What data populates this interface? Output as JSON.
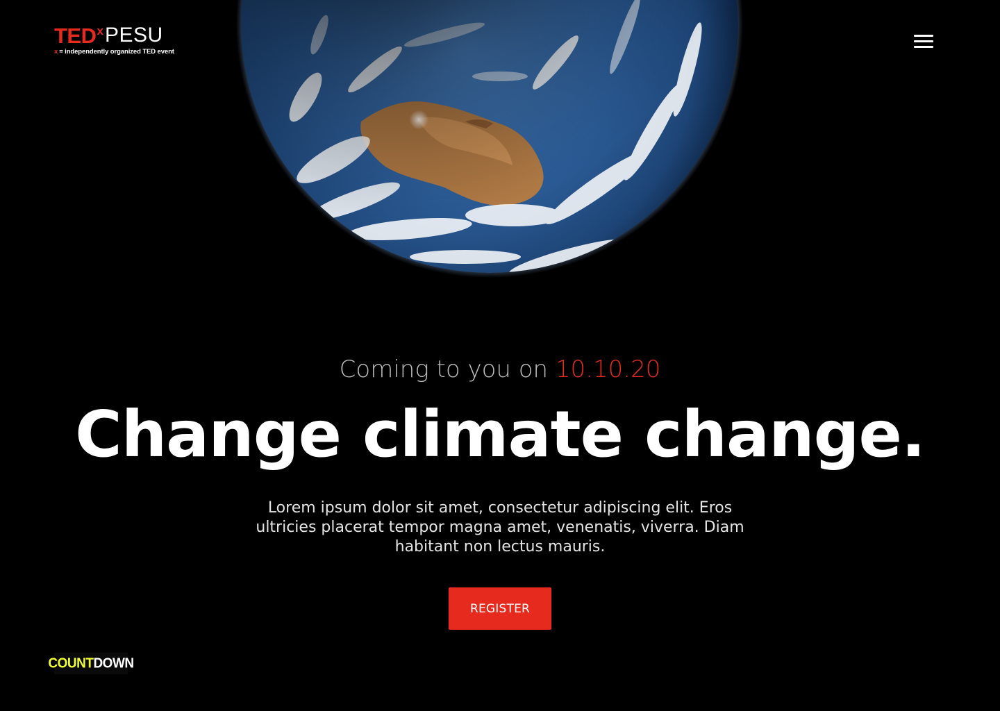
{
  "logo": {
    "ted": "TED",
    "x": "x",
    "name": "PESU",
    "tagline_x": "x",
    "tagline": "= independently organized TED event"
  },
  "menu": {
    "icon": "hamburger-menu-icon"
  },
  "hero": {
    "coming_prefix": "Coming to you on ",
    "date": "10.10.20",
    "headline": "Change climate change.",
    "description": "Lorem ipsum dolor sit amet, consectetur adipiscing elit. Eros ultricies placerat tempor magna amet, venenatis, viverra. Diam habitant non lectus mauris.",
    "register_label": "REGISTER"
  },
  "countdown": {
    "part1": "COUNT",
    "part2": "DOWN"
  },
  "colors": {
    "background": "#000000",
    "accent_red": "#e62b1e",
    "countdown_yellow": "#f0ff34"
  }
}
